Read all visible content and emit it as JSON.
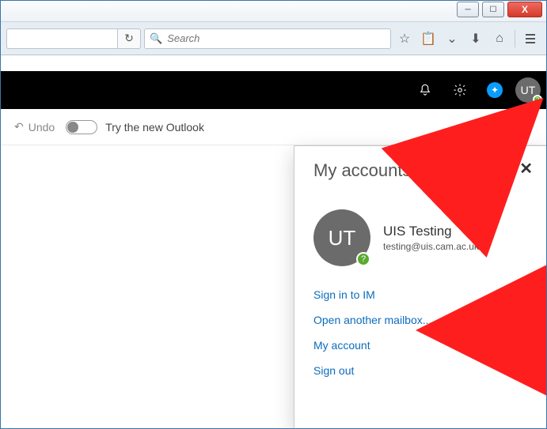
{
  "window": {
    "minimize": "–",
    "maximize": "▢",
    "close": "X"
  },
  "browser": {
    "search_placeholder": "Search"
  },
  "subbar": {
    "undo_label": "Undo",
    "toggle_label": "Try the new Outlook"
  },
  "avatar": {
    "initials": "UT",
    "presence_glyph": "?"
  },
  "panel": {
    "title": "My accounts",
    "close_glyph": "✕",
    "user": {
      "initials": "UT",
      "name": "UIS Testing",
      "email": "testing@uis.cam.ac.uk",
      "presence_glyph": "?"
    },
    "links": {
      "sign_in_im": "Sign in to IM",
      "open_mailbox": "Open another mailbox...",
      "my_account": "My account",
      "sign_out": "Sign out"
    }
  }
}
